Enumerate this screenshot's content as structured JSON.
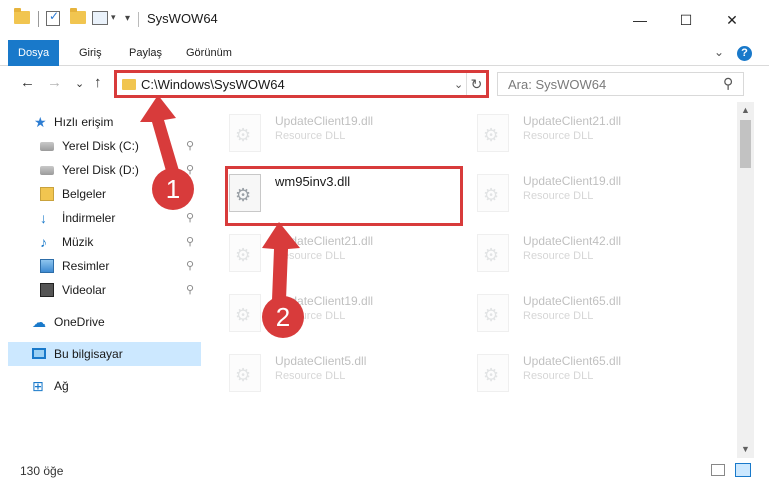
{
  "window": {
    "title": "SysWOW64",
    "minimize": "—",
    "maximize": "☐",
    "close": "✕"
  },
  "ribbon": {
    "tabs": [
      "Dosya",
      "Giriş",
      "Paylaş",
      "Görünüm"
    ],
    "active_tab": "Dosya",
    "expand_glyph": "⌄",
    "help_glyph": "?"
  },
  "navigation": {
    "back": "←",
    "forward": "→",
    "recent": "⌄",
    "up": "↑"
  },
  "address": {
    "path": "C:\\Windows\\SysWOW64",
    "dropdown_glyph": "⌄",
    "refresh_glyph": "↻"
  },
  "search": {
    "placeholder": "Ara: SysWOW64",
    "icon": "search-icon",
    "glyph": "⚲"
  },
  "sidebar": {
    "items": [
      {
        "label": "Hızlı erişim",
        "icon": "quick-access-star-icon",
        "pinned": false
      },
      {
        "label": "Yerel Disk (C:)",
        "icon": "drive-icon",
        "pinned": true
      },
      {
        "label": "Yerel Disk (D:)",
        "icon": "drive-icon",
        "pinned": true
      },
      {
        "label": "Belgeler",
        "icon": "documents-icon",
        "pinned": true
      },
      {
        "label": "İndirmeler",
        "icon": "downloads-icon",
        "pinned": true
      },
      {
        "label": "Müzik",
        "icon": "music-icon",
        "pinned": true
      },
      {
        "label": "Resimler",
        "icon": "pictures-icon",
        "pinned": true
      },
      {
        "label": "Videolar",
        "icon": "videos-icon",
        "pinned": true
      },
      {
        "label": "OneDrive",
        "icon": "onedrive-icon",
        "pinned": false
      },
      {
        "label": "Bu bilgisayar",
        "icon": "this-pc-icon",
        "pinned": false,
        "selected": true
      },
      {
        "label": "Ağ",
        "icon": "network-icon",
        "pinned": false
      }
    ],
    "pin_glyph": "📌"
  },
  "files": [
    {
      "name": "UpdateClient19.dll",
      "type": "Resource DLL",
      "faded": true
    },
    {
      "name": "UpdateClient21.dll",
      "type": "Resource DLL",
      "faded": true
    },
    {
      "name": "wm95inv3.dll",
      "type": "",
      "faded": false,
      "highlighted": true
    },
    {
      "name": "UpdateClient19.dll",
      "type": "Resource DLL",
      "faded": true
    },
    {
      "name": "UpdateClient21.dll",
      "type": "Resource DLL",
      "faded": true
    },
    {
      "name": "UpdateClient42.dll",
      "type": "Resource DLL",
      "faded": true
    },
    {
      "name": "UpdateClient19.dll",
      "type": "Resource DLL",
      "faded": true
    },
    {
      "name": "UpdateClient65.dll",
      "type": "Resource DLL",
      "faded": true
    },
    {
      "name": "UpdateClient5.dll",
      "type": "Resource DLL",
      "faded": true
    },
    {
      "name": "UpdateClient65.dll",
      "type": "Resource DLL",
      "faded": true
    }
  ],
  "annotations": {
    "step1": "1",
    "step2": "2",
    "color": "#d83b3b"
  },
  "status": {
    "item_count": "130 öğe"
  },
  "colors": {
    "accent": "#1979ca",
    "selection": "#cce8ff",
    "annotation_red": "#d83b3b"
  }
}
